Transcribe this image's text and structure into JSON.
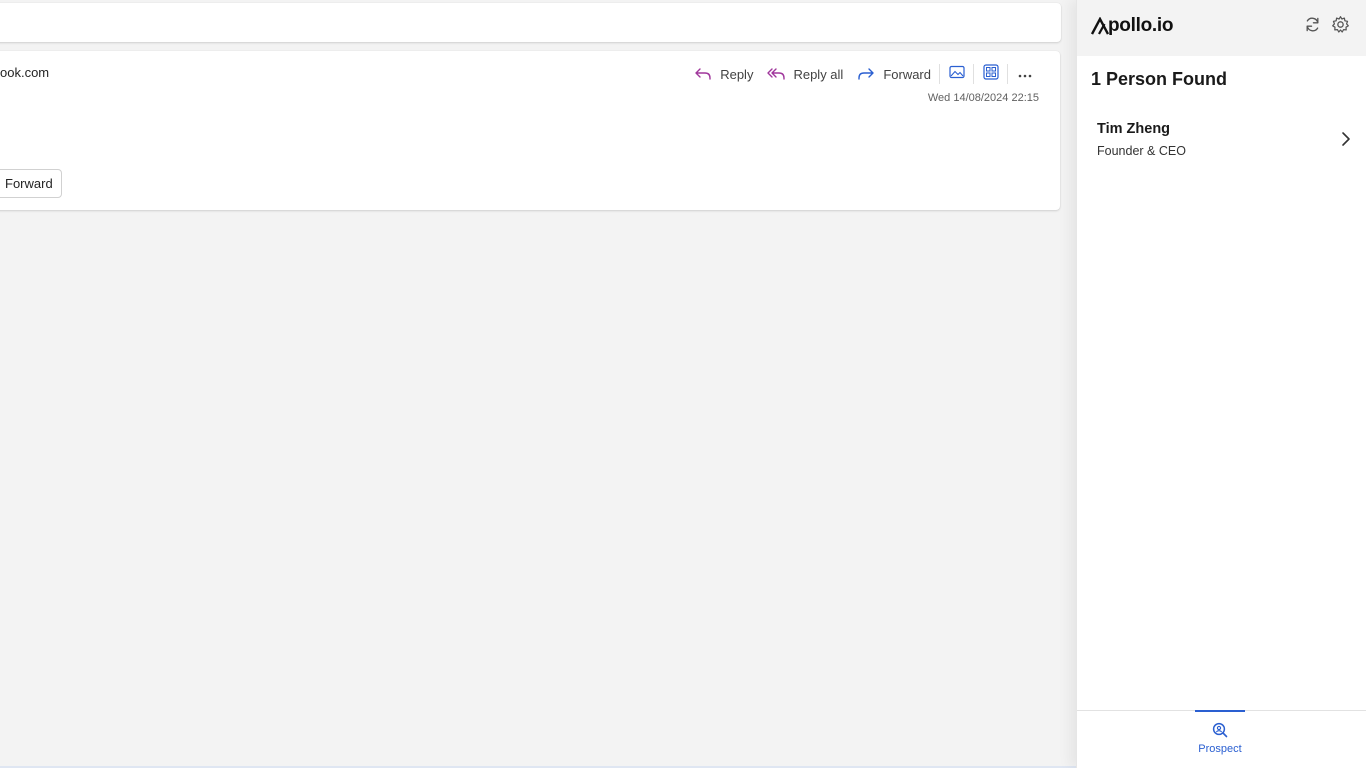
{
  "message": {
    "sender_email_fragment": "ook.com",
    "date": "Wed 14/08/2024 22:15",
    "toolbar": {
      "reply_label": "Reply",
      "reply_all_label": "Reply all",
      "forward_label": "Forward"
    },
    "forward_chip_label": "Forward"
  },
  "apollo": {
    "brand": "pollo.io",
    "results_title": "1 Person Found",
    "people": [
      {
        "name": "Tim Zheng",
        "title": "Founder & CEO"
      }
    ],
    "footer_tab_label": "Prospect",
    "colors": {
      "accent": "#2a5fd1",
      "reply_icon": "#a0379c"
    },
    "icons": [
      "refresh-icon",
      "gear-icon",
      "chevron-right-icon",
      "prospect-search-icon"
    ]
  }
}
